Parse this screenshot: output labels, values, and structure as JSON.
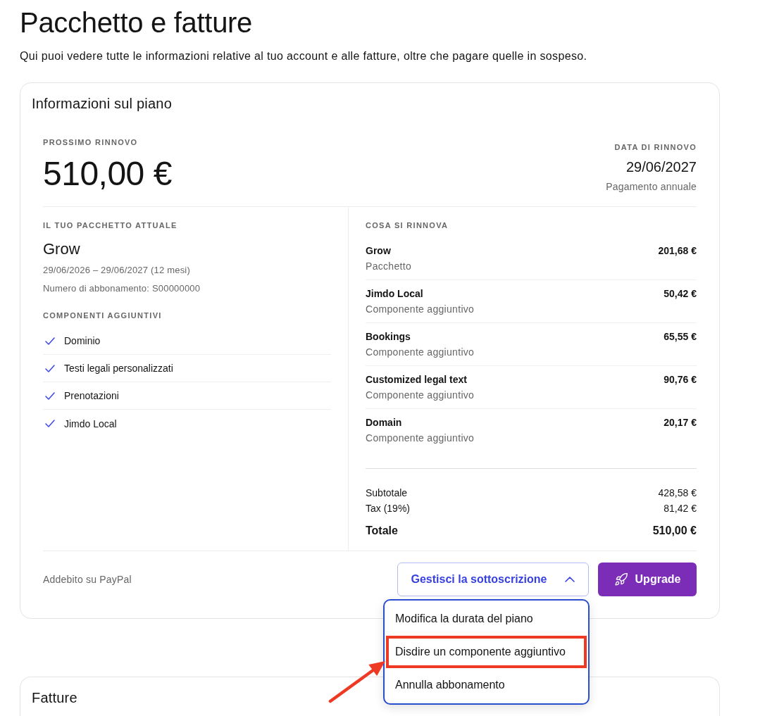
{
  "page": {
    "title": "Pacchetto e fatture",
    "description": "Qui puoi vedere tutte le informazioni relative al tuo account e alle fatture, oltre che pagare quelle in sospeso."
  },
  "plan_card": {
    "title": "Informazioni sul piano",
    "next_renewal": {
      "label": "PROSSIMO RINNOVO",
      "amount": "510,00 €"
    },
    "renewal_date": {
      "label": "DATA DI RINNOVO",
      "date": "29/06/2027",
      "billing": "Pagamento annuale"
    },
    "current_package": {
      "label": "IL TUO PACCHETTO ATTUALE",
      "name": "Grow",
      "period": "29/06/2026 – 29/06/2027 (12 mesi)",
      "subscription_number": "Numero di abbonamento: S00000000"
    },
    "addons": {
      "label": "COMPONENTI AGGIUNTIVI",
      "items": [
        {
          "name": "Dominio",
          "checked": true
        },
        {
          "name": "Testi legali personalizzati",
          "checked": true
        },
        {
          "name": "Prenotazioni",
          "checked": true
        },
        {
          "name": "Jimdo Local",
          "checked": true
        }
      ]
    },
    "renewal_items": {
      "label": "COSA SI RINNOVA",
      "items": [
        {
          "name": "Grow",
          "type": "Pacchetto",
          "price": "201,68 €"
        },
        {
          "name": "Jimdo Local",
          "type": "Componente aggiuntivo",
          "price": "50,42 €"
        },
        {
          "name": "Bookings",
          "type": "Componente aggiuntivo",
          "price": "65,55 €"
        },
        {
          "name": "Customized legal text",
          "type": "Componente aggiuntivo",
          "price": "90,76 €"
        },
        {
          "name": "Domain",
          "type": "Componente aggiuntivo",
          "price": "20,17 €"
        }
      ]
    },
    "summary": [
      {
        "kind": "line",
        "label": "Subtotale",
        "value": "428,58 €"
      },
      {
        "kind": "line",
        "label": "Tax (19%)",
        "value": "81,42 €"
      },
      {
        "kind": "total",
        "label": "Totale",
        "value": "510,00 €"
      }
    ],
    "payment_method": "Addebito su PayPal",
    "manage_button": {
      "label": "Gestisci la sottoscrizione",
      "expanded": true
    },
    "upgrade_button": {
      "label": "Upgrade"
    },
    "menu": {
      "items": [
        {
          "label": "Modifica la durata del piano",
          "highlighted": false
        },
        {
          "label": "Disdire un componente aggiuntivo",
          "highlighted": true
        },
        {
          "label": "Annulla abbonamento",
          "highlighted": false
        }
      ]
    }
  },
  "invoices_card": {
    "title": "Fatture"
  }
}
